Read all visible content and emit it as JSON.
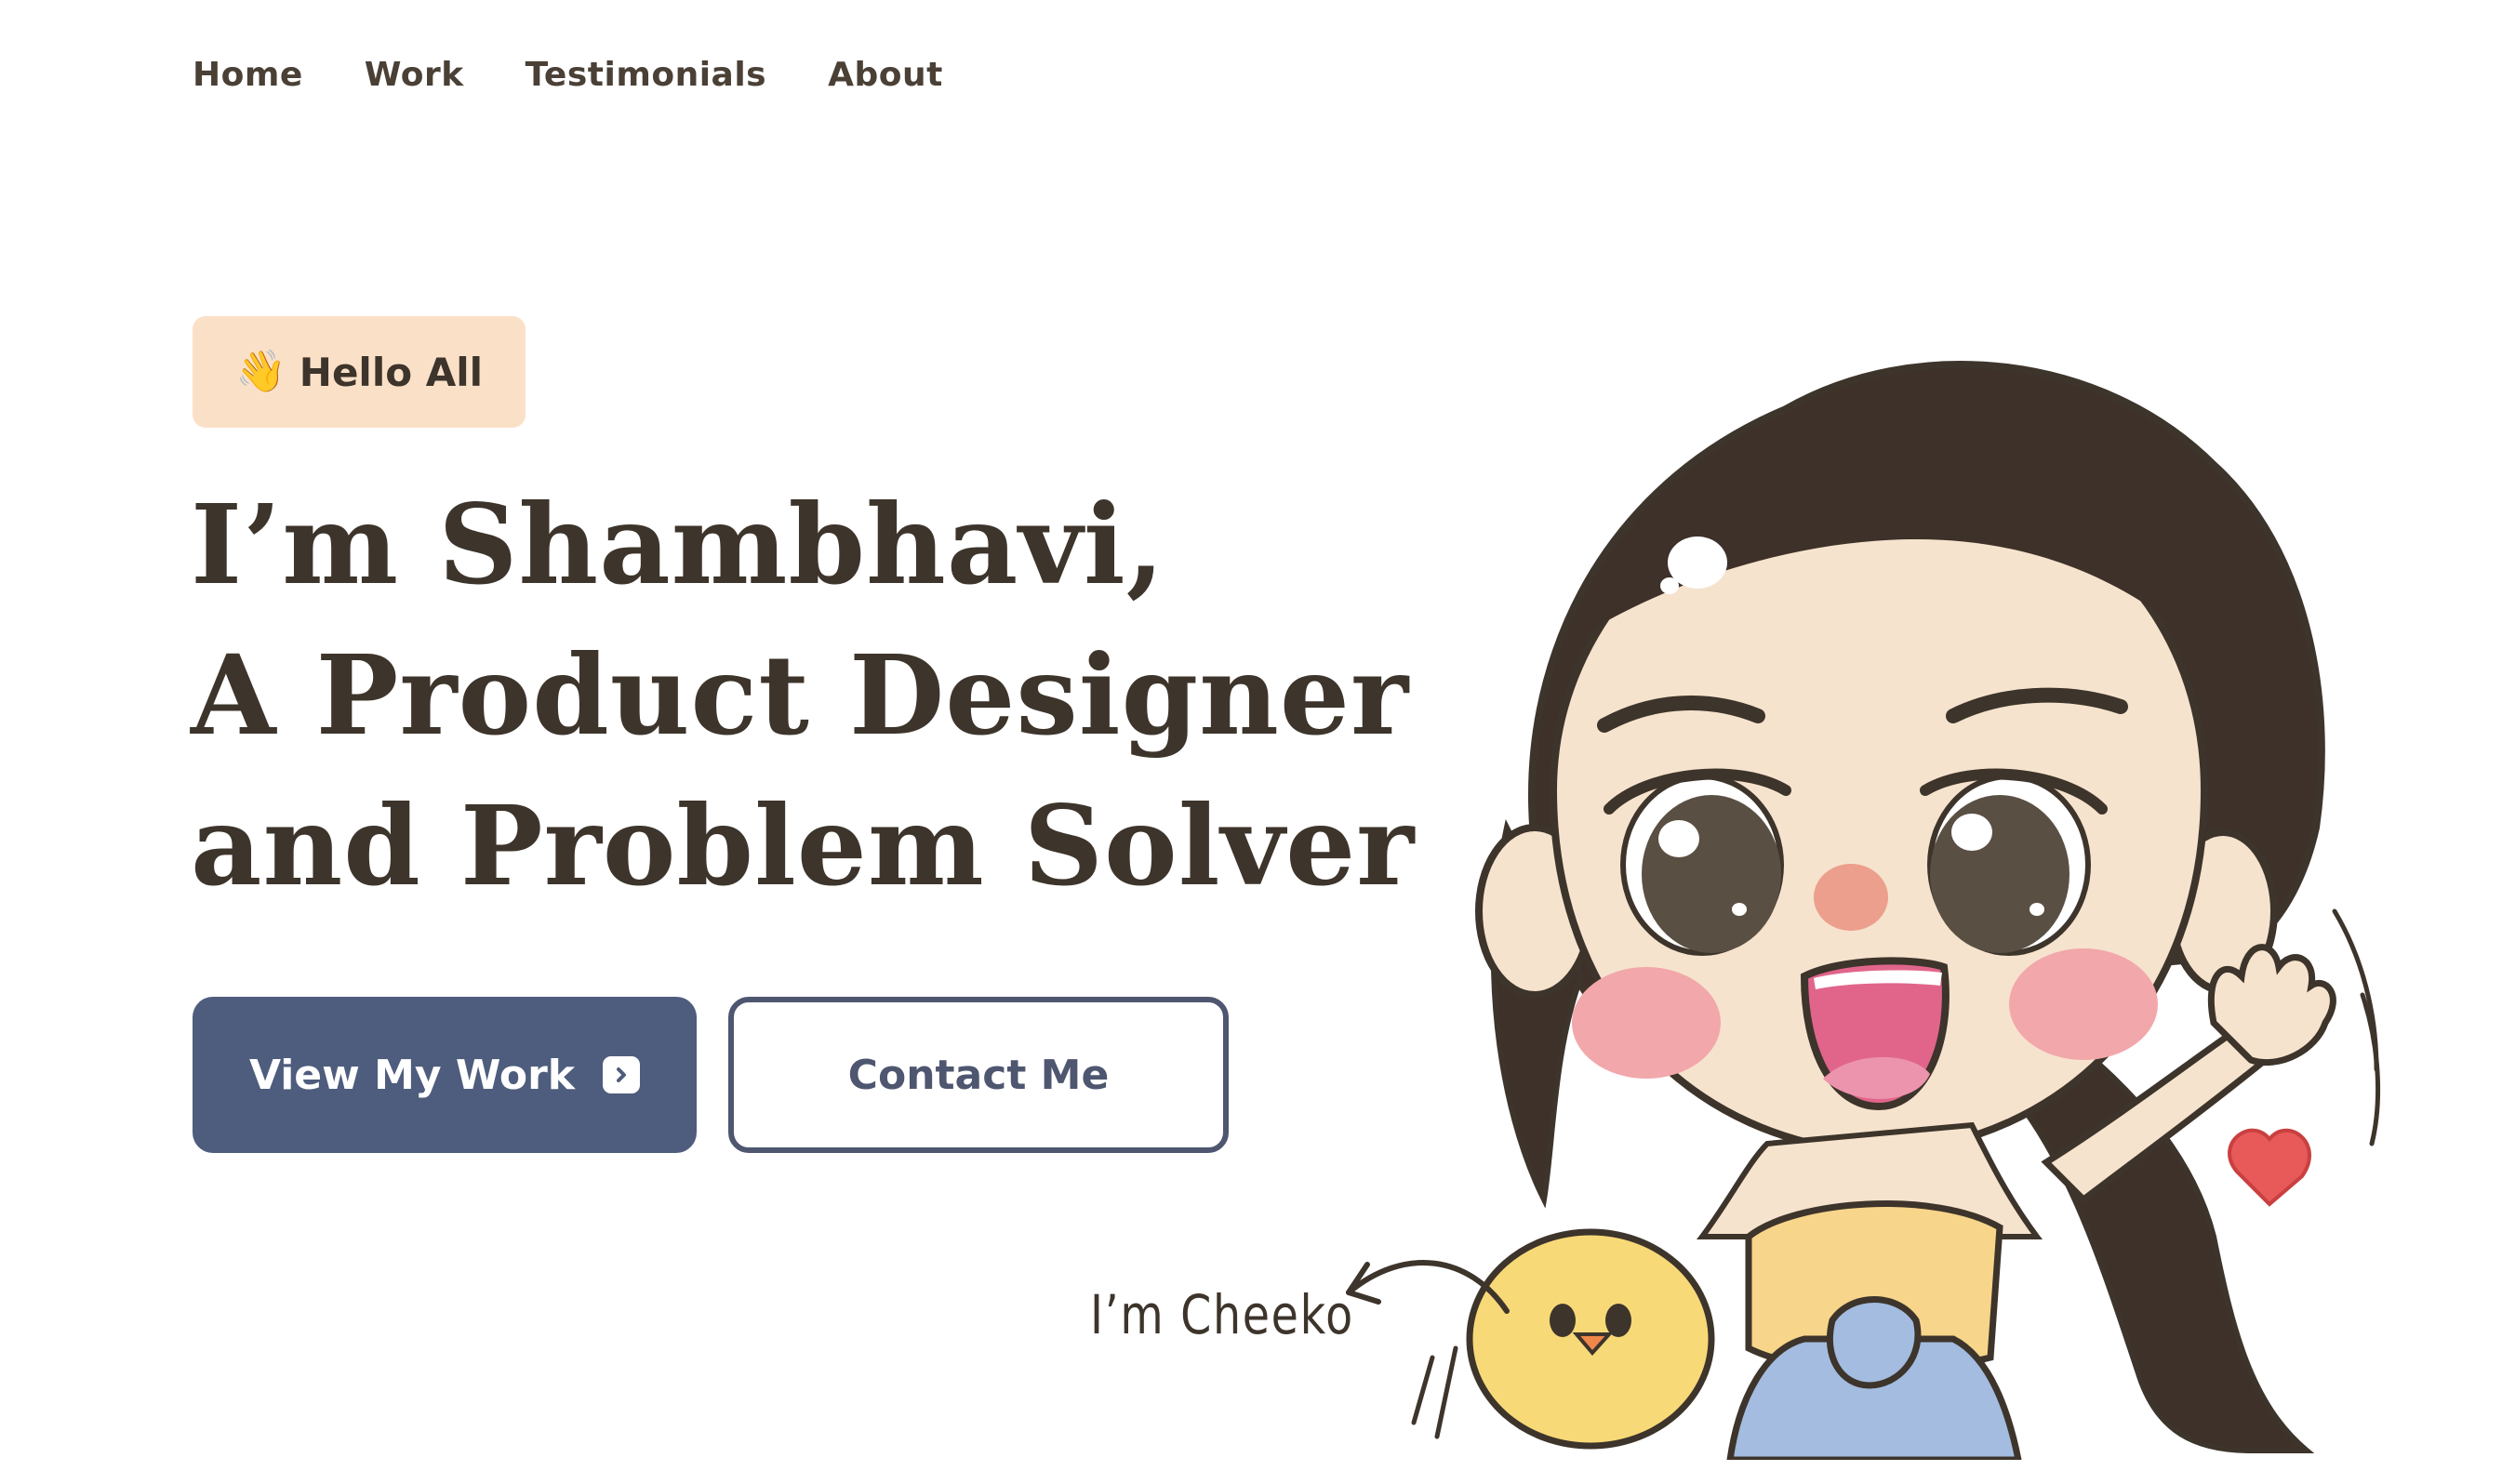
{
  "nav": {
    "items": [
      "Home",
      "Work",
      "Testimonials",
      "About"
    ]
  },
  "hero": {
    "badge_emoji": "👋",
    "badge_label": "Hello All",
    "headline": [
      "I’m Shambhavi,",
      "A Product Designer",
      "and Problem Solver"
    ],
    "primary_button": "View My Work",
    "secondary_button": "Contact Me",
    "mascot_caption": "I’m Cheeko"
  },
  "colors": {
    "text": "#3d342b",
    "badge_bg": "#fbe0c8",
    "primary": "#4e5d7d",
    "outline": "#4e5670"
  }
}
